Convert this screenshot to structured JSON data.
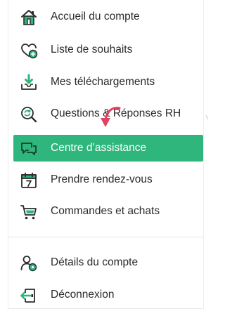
{
  "menu": {
    "items": [
      {
        "label": "Accueil du compte",
        "icon": "home-icon"
      },
      {
        "label": "Liste de souhaits",
        "icon": "heart-add-icon"
      },
      {
        "label": "Mes téléchargements",
        "icon": "download-tray-icon"
      },
      {
        "label": "Questions & Réponses RH",
        "icon": "magnifier-refresh-icon"
      },
      {
        "label": "Centre d’assistance",
        "icon": "chat-bubbles-icon",
        "active": true
      },
      {
        "label": "Prendre rendez-vous",
        "icon": "calendar-icon"
      },
      {
        "label": "Commandes et achats",
        "icon": "cart-icon"
      },
      {
        "label": "Détails du compte",
        "icon": "user-settings-icon"
      },
      {
        "label": "Déconnexion",
        "icon": "logout-icon"
      }
    ]
  },
  "colors": {
    "active_bg": "#2eb67d",
    "icon_green": "#2eb67d",
    "icon_dark": "#2b2b2b",
    "arrow": "#e4405f"
  }
}
